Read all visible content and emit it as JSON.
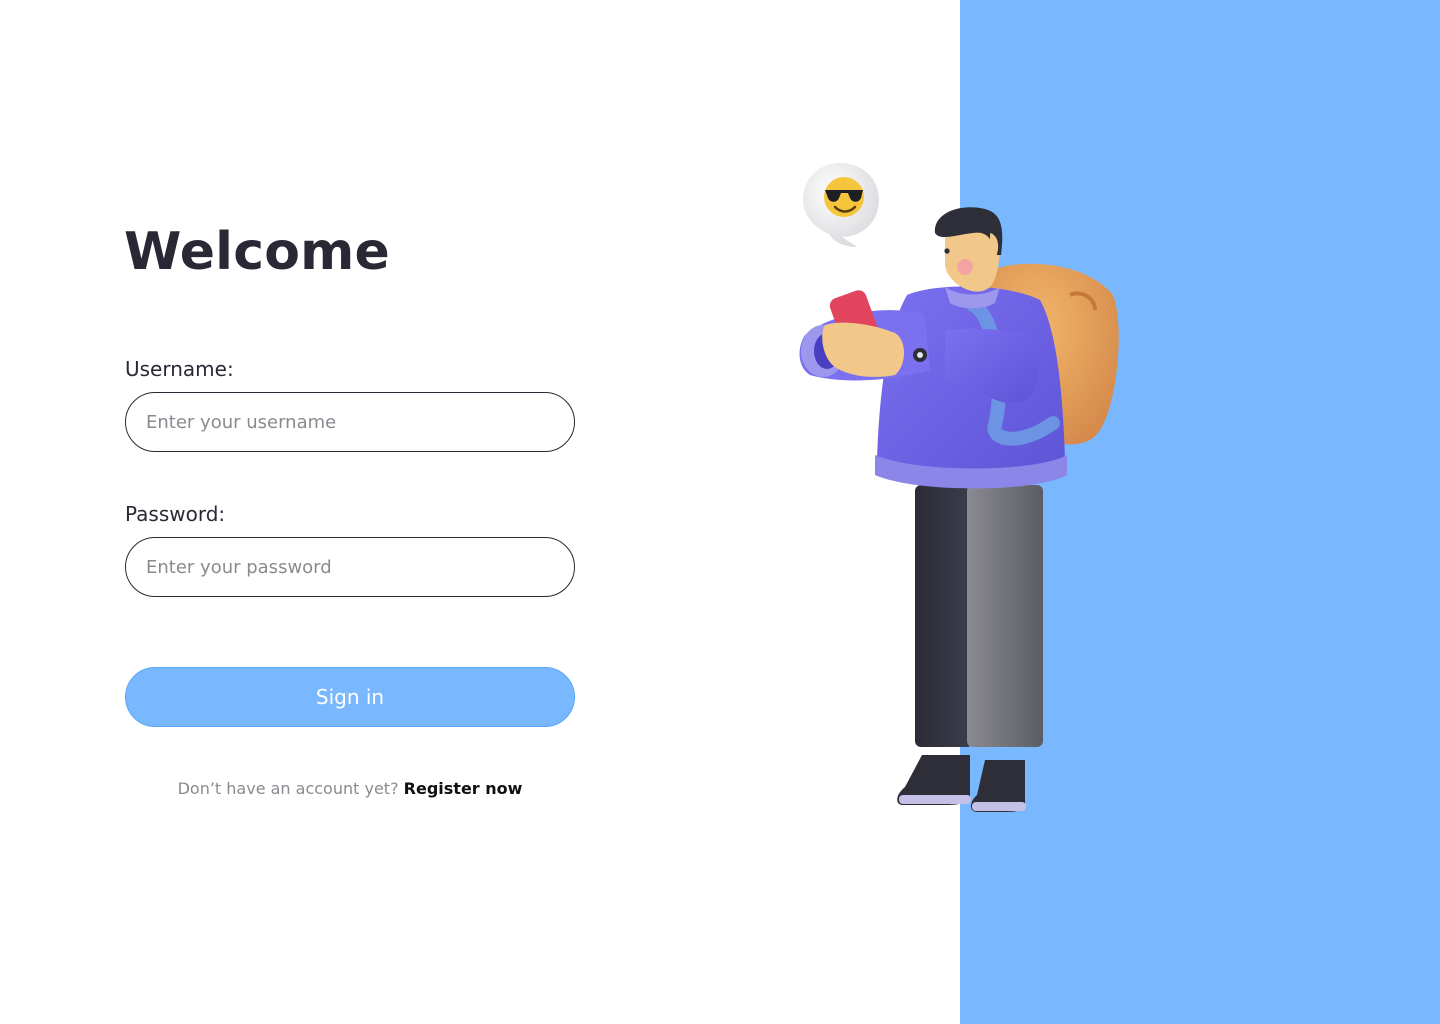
{
  "heading": "Welcome",
  "form": {
    "username_label": "Username:",
    "username_placeholder": "Enter your username",
    "password_label": "Password:",
    "password_placeholder": "Enter your password",
    "submit_label": "Sign in"
  },
  "footer": {
    "prompt": "Don’t have an account yet?",
    "link_label": "Register now"
  },
  "illustration": {
    "subject": "person-with-backpack-using-phone",
    "speech_bubble_icon": "sunglasses-emoji-icon"
  },
  "colors": {
    "accent": "#79b8ff",
    "text_dark": "#282935",
    "text_muted": "#8a8a90",
    "background": "#ffffff"
  }
}
